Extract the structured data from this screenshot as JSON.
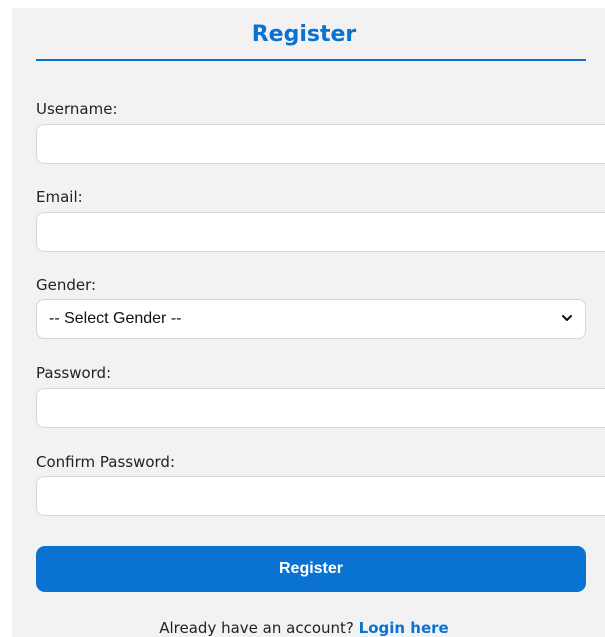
{
  "form": {
    "title": "Register",
    "fields": {
      "username": {
        "label": "Username:",
        "value": "",
        "placeholder": ""
      },
      "email": {
        "label": "Email:",
        "value": "",
        "placeholder": ""
      },
      "gender": {
        "label": "Gender:",
        "selected": "-- Select Gender --"
      },
      "password": {
        "label": "Password:",
        "value": "",
        "placeholder": ""
      },
      "confirm_password": {
        "label": "Confirm Password:",
        "value": "",
        "placeholder": ""
      }
    },
    "submit_label": "Register",
    "footer_text": "Already have an account?",
    "login_link": "Login here"
  },
  "colors": {
    "accent": "#0a72d1",
    "panel_bg": "#f2f2f2"
  },
  "icons": {
    "select_chevron": "chevron-down-icon"
  }
}
